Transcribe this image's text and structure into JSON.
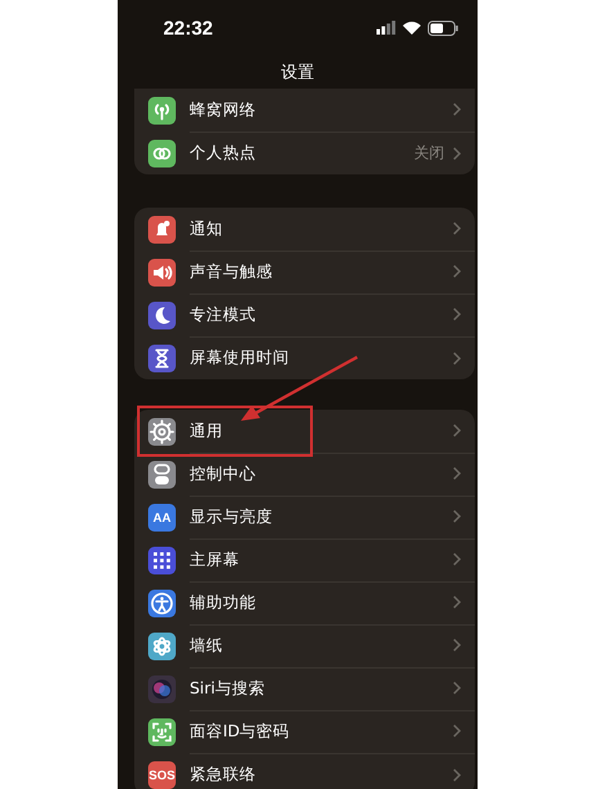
{
  "status_bar": {
    "time": "22:32"
  },
  "nav": {
    "title": "设置"
  },
  "groups": [
    {
      "items": [
        {
          "label": "蜂窝网络",
          "color": "#5fb85f",
          "highlighted": false
        },
        {
          "label": "个人热点",
          "value": "关闭",
          "color": "#5fb85f",
          "highlighted": false
        }
      ]
    },
    {
      "items": [
        {
          "label": "通知",
          "color": "#d9534b",
          "highlighted": false
        },
        {
          "label": "声音与触感",
          "color": "#d9534b",
          "highlighted": false
        },
        {
          "label": "专注模式",
          "color": "#5856c8",
          "highlighted": false
        },
        {
          "label": "屏幕使用时间",
          "color": "#5856c8",
          "highlighted": false
        }
      ]
    },
    {
      "items": [
        {
          "label": "通用",
          "color": "#8a8a8e",
          "highlighted": true
        },
        {
          "label": "控制中心",
          "color": "#8a8a8e",
          "highlighted": false
        },
        {
          "label": "显示与亮度",
          "color": "#3a78e0",
          "icon_text": "AA",
          "highlighted": false
        },
        {
          "label": "主屏幕",
          "color": "#4a4ed8",
          "highlighted": false
        },
        {
          "label": "辅助功能",
          "color": "#3a78e0",
          "highlighted": false
        },
        {
          "label": "墙纸",
          "color": "#4fa8c8",
          "highlighted": false
        },
        {
          "label": "Siri与搜索",
          "color": "#3a3040",
          "highlighted": false
        },
        {
          "label": "面容ID与密码",
          "color": "#5fb85f",
          "highlighted": false
        },
        {
          "label": "紧急联络",
          "color": "#d9534b",
          "icon_text": "SOS",
          "highlighted": false
        }
      ]
    }
  ]
}
